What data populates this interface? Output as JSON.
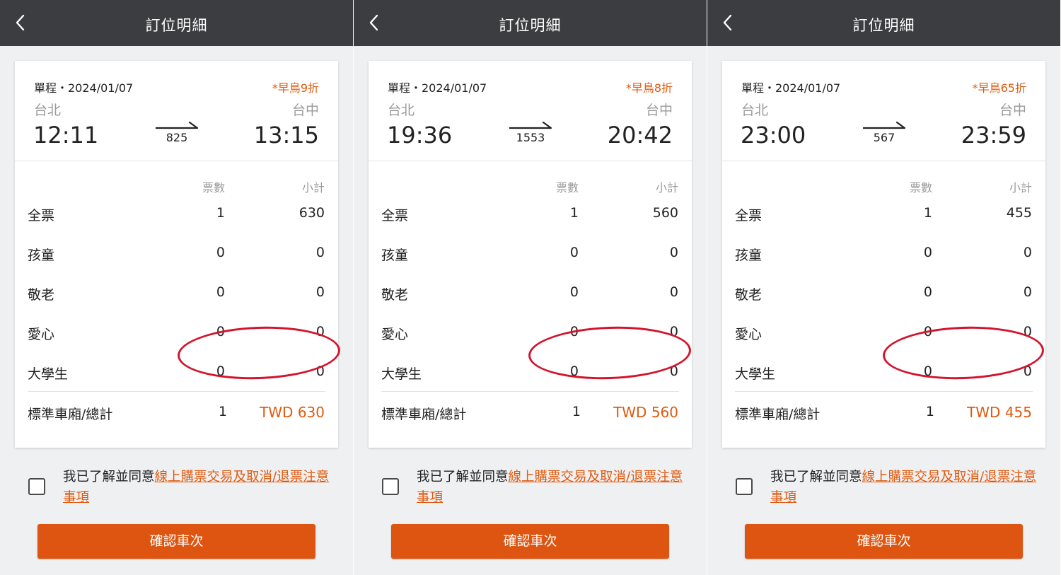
{
  "common": {
    "header_title": "訂位明細",
    "back_icon": "chevron-left-icon",
    "train_icon": "arrow-right-icon",
    "col_tickets": "票數",
    "col_subtotal": "小計",
    "agree_prefix": "我已了解並同意",
    "agree_link": "線上購票交易及取消/退票注意事項",
    "confirm_label": "確認車次",
    "colors": {
      "header_bg": "#3b3d41",
      "accent": "#e05a0f",
      "button_bg": "#dd5511",
      "highlight_circle": "#d3142c"
    }
  },
  "screens": [
    {
      "trip_type": "單程・2024/01/07",
      "discount": "*早鳥9折",
      "origin": "台北",
      "destination": "台中",
      "departure_time": "12:11",
      "arrival_time": "13:15",
      "train_no": "825",
      "rows": [
        {
          "label": "全票",
          "qty": "1",
          "subtotal": "630"
        },
        {
          "label": "孩童",
          "qty": "0",
          "subtotal": "0"
        },
        {
          "label": "敬老",
          "qty": "0",
          "subtotal": "0"
        },
        {
          "label": "愛心",
          "qty": "0",
          "subtotal": "0"
        },
        {
          "label": "大學生",
          "qty": "0",
          "subtotal": "0"
        }
      ],
      "total_label": "標準車廂/總計",
      "total_qty": "1",
      "total_amount": "TWD 630"
    },
    {
      "trip_type": "單程・2024/01/07",
      "discount": "*早鳥8折",
      "origin": "台北",
      "destination": "台中",
      "departure_time": "19:36",
      "arrival_time": "20:42",
      "train_no": "1553",
      "rows": [
        {
          "label": "全票",
          "qty": "1",
          "subtotal": "560"
        },
        {
          "label": "孩童",
          "qty": "0",
          "subtotal": "0"
        },
        {
          "label": "敬老",
          "qty": "0",
          "subtotal": "0"
        },
        {
          "label": "愛心",
          "qty": "0",
          "subtotal": "0"
        },
        {
          "label": "大學生",
          "qty": "0",
          "subtotal": "0"
        }
      ],
      "total_label": "標準車廂/總計",
      "total_qty": "1",
      "total_amount": "TWD 560"
    },
    {
      "trip_type": "單程・2024/01/07",
      "discount": "*早鳥65折",
      "origin": "台北",
      "destination": "台中",
      "departure_time": "23:00",
      "arrival_time": "23:59",
      "train_no": "567",
      "rows": [
        {
          "label": "全票",
          "qty": "1",
          "subtotal": "455"
        },
        {
          "label": "孩童",
          "qty": "0",
          "subtotal": "0"
        },
        {
          "label": "敬老",
          "qty": "0",
          "subtotal": "0"
        },
        {
          "label": "愛心",
          "qty": "0",
          "subtotal": "0"
        },
        {
          "label": "大學生",
          "qty": "0",
          "subtotal": "0"
        }
      ],
      "total_label": "標準車廂/總計",
      "total_qty": "1",
      "total_amount": "TWD 455"
    }
  ]
}
